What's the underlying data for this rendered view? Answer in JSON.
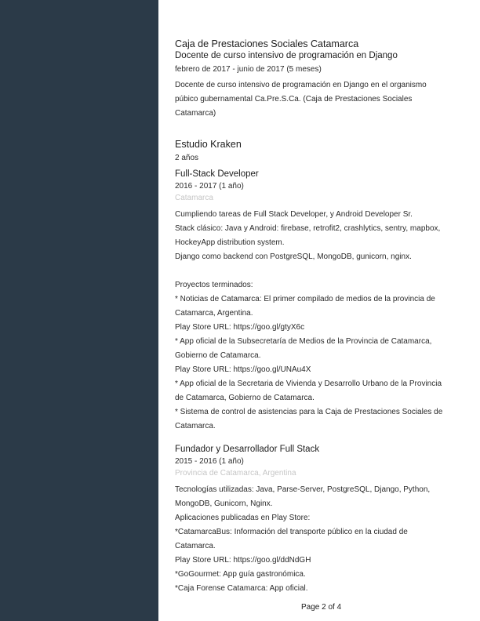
{
  "jobs": {
    "caja": {
      "org": "Caja de Prestaciones Sociales Catamarca",
      "role": "Docente de curso intensivo de programación en Django",
      "dates": "febrero de 2017 - junio de 2017 (5 meses)",
      "desc": [
        "Docente de curso intensivo de programación en Django en el organismo",
        "púbico gubernamental Ca.Pre.S.Ca. (Caja de Prestaciones Sociales",
        "Catamarca)"
      ]
    },
    "kraken": {
      "org": "Estudio Kraken",
      "duration": "2 años",
      "positions": [
        {
          "role": "Full-Stack Developer",
          "dates": "2016 - 2017 (1 año)",
          "location": "Catamarca",
          "desc": [
            "Cumpliendo tareas de Full Stack Developer, y Android Developer Sr.",
            "Stack clásico: Java y Android: firebase, retrofit2, crashlytics, sentry, mapbox,",
            "HockeyApp distribution system.",
            "Django como backend con PostgreSQL, MongoDB, gunicorn, nginx.",
            "",
            "Proyectos terminados:",
            "* Noticias de Catamarca: El primer compilado de medios de la provincia de",
            "Catamarca, Argentina.",
            "Play Store URL: https://goo.gl/gtyX6c",
            "* App oficial de la Subsecretaría de Medios de la Provincia de Catamarca,",
            "Gobierno de Catamarca.",
            "Play Store URL: https://goo.gl/UNAu4X",
            "* App oficial de la Secretaria de Vivienda y Desarrollo Urbano de la Provincia",
            "de Catamarca, Gobierno de Catamarca.",
            "* Sistema de control de asistencias para la Caja de Prestaciones Sociales de",
            "Catamarca."
          ]
        },
        {
          "role": "Fundador y Desarrollador Full Stack",
          "dates": "2015 - 2016 (1 año)",
          "location": "Provincia de Catamarca, Argentina",
          "desc": [
            "Tecnologías utilizadas: Java, Parse-Server, PostgreSQL, Django, Python,",
            "MongoDB, Gunicorn, Nginx.",
            "Aplicaciones publicadas en Play Store:",
            "*CatamarcaBus: Información del transporte público en la ciudad de",
            "Catamarca.",
            "Play Store URL: https://goo.gl/ddNdGH",
            "*GoGourmet: App guía gastronómica.",
            "*Caja Forense Catamarca: App oficial."
          ]
        }
      ]
    }
  },
  "footer": {
    "page": "Page 2 of 4"
  }
}
